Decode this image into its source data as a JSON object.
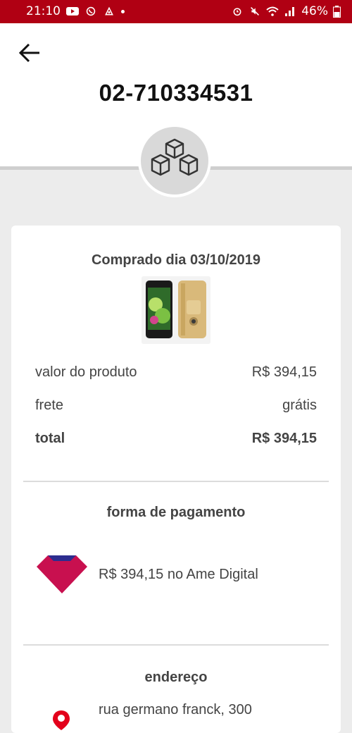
{
  "status_bar": {
    "time": "21:10",
    "battery": "46%"
  },
  "header": {
    "order_number": "02-710334531"
  },
  "order": {
    "purchase_date": "Comprado dia 03/10/2019",
    "rows": [
      {
        "label": "valor do produto",
        "value": "R$ 394,15"
      },
      {
        "label": "frete",
        "value": "grátis"
      },
      {
        "label": "total",
        "value": "R$ 394,15"
      }
    ]
  },
  "payment": {
    "title": "forma de pagamento",
    "text": "R$ 394,15 no Ame Digital"
  },
  "address": {
    "title": "endereço",
    "line1": "rua germano franck, 300"
  },
  "colors": {
    "status_bar": "#b00013",
    "ame_brand": "#c8104f",
    "pin": "#e3001b"
  }
}
